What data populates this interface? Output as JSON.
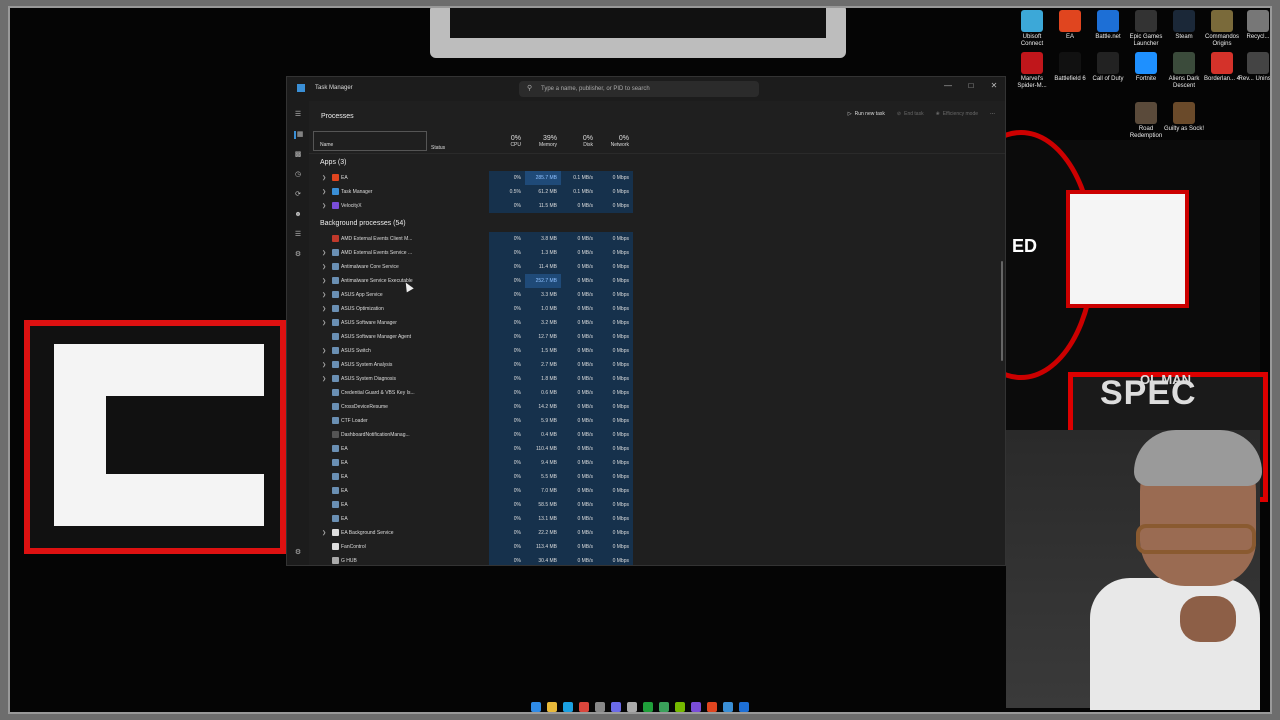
{
  "window": {
    "title": "Task Manager",
    "search_placeholder": "Type a name, publisher, or PID to search",
    "min": "—",
    "max": "□",
    "close": "✕"
  },
  "page": {
    "title": "Processes"
  },
  "toolbar": {
    "run_new_task": "Run new task",
    "end_task": "End task",
    "efficiency_mode": "Efficiency mode",
    "more": "⋯"
  },
  "columns": {
    "name": "Name",
    "status": "Status",
    "cpu_pct": "0%",
    "cpu": "CPU",
    "mem_pct": "39%",
    "mem": "Memory",
    "disk_pct": "0%",
    "disk": "Disk",
    "net_pct": "0%",
    "net": "Network"
  },
  "groups": {
    "apps": "Apps (3)",
    "background": "Background processes (54)"
  },
  "apps": [
    {
      "name": "EA",
      "cpu": "0%",
      "mem": "285.7 MB",
      "disk": "0.1 MB/s",
      "net": "0 Mbps",
      "icon_color": "#e0451f",
      "hot": true
    },
    {
      "name": "Task Manager",
      "cpu": "0.5%",
      "mem": "61.2 MB",
      "disk": "0.1 MB/s",
      "net": "0 Mbps",
      "icon_color": "#3a8fd6",
      "hot": false
    },
    {
      "name": "VelocityX",
      "cpu": "0%",
      "mem": "11.5 MB",
      "disk": "0 MB/s",
      "net": "0 Mbps",
      "icon_color": "#7a4dd8",
      "hot": false
    }
  ],
  "background": [
    {
      "name": "AMD External Events Client M...",
      "cpu": "0%",
      "mem": "3.8 MB",
      "disk": "0 MB/s",
      "net": "0 Mbps",
      "icon_color": "#c0392b",
      "chev": false
    },
    {
      "name": "AMD External Events Service ...",
      "cpu": "0%",
      "mem": "1.3 MB",
      "disk": "0 MB/s",
      "net": "0 Mbps",
      "icon_color": "#6a8fb3",
      "chev": true
    },
    {
      "name": "Antimalware Core Service",
      "cpu": "0%",
      "mem": "11.4 MB",
      "disk": "0 MB/s",
      "net": "0 Mbps",
      "icon_color": "#6a8fb3",
      "chev": true
    },
    {
      "name": "Antimalware Service Executable",
      "cpu": "0%",
      "mem": "252.7 MB",
      "disk": "0 MB/s",
      "net": "0 Mbps",
      "icon_color": "#6a8fb3",
      "chev": true,
      "hot": true
    },
    {
      "name": "ASUS App Service",
      "cpu": "0%",
      "mem": "3.3 MB",
      "disk": "0 MB/s",
      "net": "0 Mbps",
      "icon_color": "#6a8fb3",
      "chev": true
    },
    {
      "name": "ASUS Optimization",
      "cpu": "0%",
      "mem": "1.0 MB",
      "disk": "0 MB/s",
      "net": "0 Mbps",
      "icon_color": "#6a8fb3",
      "chev": true
    },
    {
      "name": "ASUS Software Manager",
      "cpu": "0%",
      "mem": "3.2 MB",
      "disk": "0 MB/s",
      "net": "0 Mbps",
      "icon_color": "#6a8fb3",
      "chev": true
    },
    {
      "name": "ASUS Software Manager Agent",
      "cpu": "0%",
      "mem": "12.7 MB",
      "disk": "0 MB/s",
      "net": "0 Mbps",
      "icon_color": "#6a8fb3",
      "chev": false
    },
    {
      "name": "ASUS Switch",
      "cpu": "0%",
      "mem": "1.5 MB",
      "disk": "0 MB/s",
      "net": "0 Mbps",
      "icon_color": "#6a8fb3",
      "chev": true
    },
    {
      "name": "ASUS System Analysis",
      "cpu": "0%",
      "mem": "2.7 MB",
      "disk": "0 MB/s",
      "net": "0 Mbps",
      "icon_color": "#6a8fb3",
      "chev": true
    },
    {
      "name": "ASUS System Diagnosis",
      "cpu": "0%",
      "mem": "1.8 MB",
      "disk": "0 MB/s",
      "net": "0 Mbps",
      "icon_color": "#6a8fb3",
      "chev": true
    },
    {
      "name": "Credential Guard & VBS Key Is...",
      "cpu": "0%",
      "mem": "0.6 MB",
      "disk": "0 MB/s",
      "net": "0 Mbps",
      "icon_color": "#6a8fb3",
      "chev": false
    },
    {
      "name": "CrossDeviceResume",
      "cpu": "0%",
      "mem": "14.2 MB",
      "disk": "0 MB/s",
      "net": "0 Mbps",
      "icon_color": "#6a8fb3",
      "chev": false
    },
    {
      "name": "CTF Loader",
      "cpu": "0%",
      "mem": "5.9 MB",
      "disk": "0 MB/s",
      "net": "0 Mbps",
      "icon_color": "#6a8fb3",
      "chev": false
    },
    {
      "name": "DashboardNotificationManag...",
      "cpu": "0%",
      "mem": "0.4 MB",
      "disk": "0 MB/s",
      "net": "0 Mbps",
      "icon_color": "#555555",
      "chev": false
    },
    {
      "name": "EA",
      "cpu": "0%",
      "mem": "110.4 MB",
      "disk": "0 MB/s",
      "net": "0 Mbps",
      "icon_color": "#6a8fb3",
      "chev": false
    },
    {
      "name": "EA",
      "cpu": "0%",
      "mem": "9.4 MB",
      "disk": "0 MB/s",
      "net": "0 Mbps",
      "icon_color": "#6a8fb3",
      "chev": false
    },
    {
      "name": "EA",
      "cpu": "0%",
      "mem": "5.5 MB",
      "disk": "0 MB/s",
      "net": "0 Mbps",
      "icon_color": "#6a8fb3",
      "chev": false
    },
    {
      "name": "EA",
      "cpu": "0%",
      "mem": "7.0 MB",
      "disk": "0 MB/s",
      "net": "0 Mbps",
      "icon_color": "#6a8fb3",
      "chev": false
    },
    {
      "name": "EA",
      "cpu": "0%",
      "mem": "58.5 MB",
      "disk": "0 MB/s",
      "net": "0 Mbps",
      "icon_color": "#6a8fb3",
      "chev": false
    },
    {
      "name": "EA",
      "cpu": "0%",
      "mem": "13.1 MB",
      "disk": "0 MB/s",
      "net": "0 Mbps",
      "icon_color": "#6a8fb3",
      "chev": false
    },
    {
      "name": "EA Background Service",
      "cpu": "0%",
      "mem": "22.2 MB",
      "disk": "0 MB/s",
      "net": "0 Mbps",
      "icon_color": "#dddddd",
      "chev": true
    },
    {
      "name": "FanControl",
      "cpu": "0%",
      "mem": "113.4 MB",
      "disk": "0 MB/s",
      "net": "0 Mbps",
      "icon_color": "#dddddd",
      "chev": false
    },
    {
      "name": "G HUB",
      "cpu": "0%",
      "mem": "30.4 MB",
      "disk": "0 MB/s",
      "net": "0 Mbps",
      "icon_color": "#aaaaaa",
      "chev": false
    }
  ],
  "desktop_icons": [
    {
      "label": "Ubisoft Connect",
      "color": "#3ca8d8"
    },
    {
      "label": "EA",
      "color": "#e0451f"
    },
    {
      "label": "Battle.net",
      "color": "#1d6fd6"
    },
    {
      "label": "Epic Games Launcher",
      "color": "#333333"
    },
    {
      "label": "Steam",
      "color": "#1b2838"
    },
    {
      "label": "Commandos Origins",
      "color": "#7a6a3a"
    },
    {
      "label": "Recycl...",
      "color": "#777777"
    },
    {
      "label": "Marvel's Spider-M...",
      "color": "#c0161b"
    },
    {
      "label": "Battlefield 6",
      "color": "#111111"
    },
    {
      "label": "Call of Duty",
      "color": "#222222"
    },
    {
      "label": "Fortnite",
      "color": "#1e90ff"
    },
    {
      "label": "Aliens Dark Descent",
      "color": "#3b4b3b"
    },
    {
      "label": "Borderlan... 4",
      "color": "#d4322a"
    },
    {
      "label": "Rev... Uninst...",
      "color": "#444444"
    },
    {
      "label": "Road Redemption",
      "color": "#5a4a3a"
    },
    {
      "label": "Guilty as Sock!",
      "color": "#6a4a2a"
    }
  ],
  "overlay": {
    "brand_small": "OL MAN",
    "brand_big": "SPEC",
    "ted": "ED"
  }
}
